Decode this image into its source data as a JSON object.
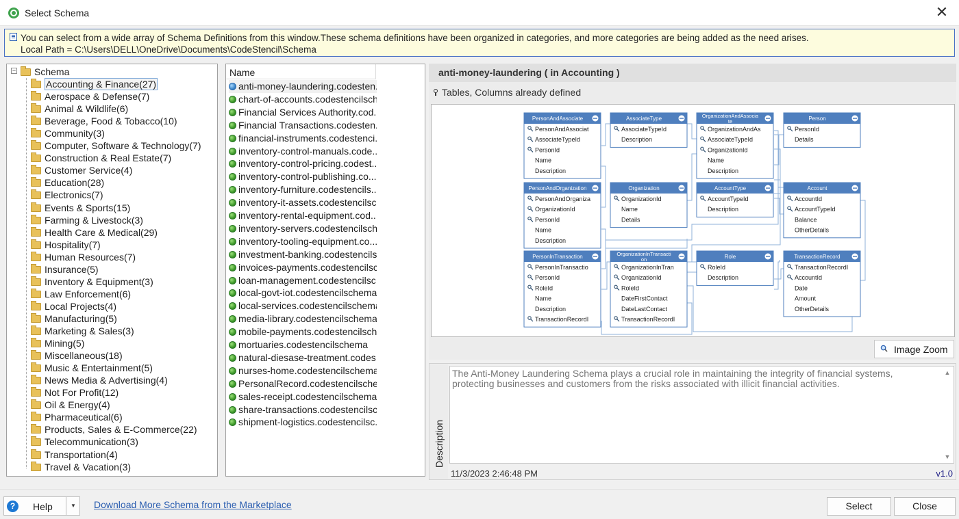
{
  "window": {
    "title": "Select Schema",
    "close_glyph": "✕"
  },
  "banner": {
    "line1": "You can select from a wide array of Schema Definitions from this window.These schema definitions have been organized in categories, and more categories are being added as the need arises.",
    "line2": "Local Path = C:\\Users\\DELL\\OneDrive\\Documents\\CodeStencil\\Schema"
  },
  "tree": {
    "root": "Schema",
    "expander": "−",
    "items": [
      {
        "label": "Accounting & Finance(27)",
        "selected": true
      },
      {
        "label": "Aerospace & Defense(7)"
      },
      {
        "label": "Animal & Wildlife(6)"
      },
      {
        "label": "Beverage, Food & Tobacco(10)"
      },
      {
        "label": "Community(3)"
      },
      {
        "label": "Computer, Software & Technology(7)"
      },
      {
        "label": "Construction & Real Estate(7)"
      },
      {
        "label": "Customer Service(4)"
      },
      {
        "label": "Education(28)"
      },
      {
        "label": "Electronics(7)"
      },
      {
        "label": "Events & Sports(15)"
      },
      {
        "label": "Farming & Livestock(3)"
      },
      {
        "label": "Health Care & Medical(29)"
      },
      {
        "label": "Hospitality(7)"
      },
      {
        "label": "Human Resources(7)"
      },
      {
        "label": "Insurance(5)"
      },
      {
        "label": "Inventory & Equipment(3)"
      },
      {
        "label": "Law Enforcement(6)"
      },
      {
        "label": "Local Projects(4)"
      },
      {
        "label": "Manufacturing(5)"
      },
      {
        "label": "Marketing & Sales(3)"
      },
      {
        "label": "Mining(5)"
      },
      {
        "label": "Miscellaneous(18)"
      },
      {
        "label": "Music & Entertainment(5)"
      },
      {
        "label": "News Media & Advertising(4)"
      },
      {
        "label": "Not For Profit(12)"
      },
      {
        "label": "Oil & Energy(4)"
      },
      {
        "label": "Pharmaceutical(6)"
      },
      {
        "label": "Products, Sales & E-Commerce(22)"
      },
      {
        "label": "Telecommunication(3)"
      },
      {
        "label": "Transportation(4)"
      },
      {
        "label": "Travel & Vacation(3)"
      }
    ]
  },
  "list": {
    "header": "Name",
    "items": [
      {
        "label": "anti-money-laundering.codesten...",
        "selected": true,
        "icon": "blue"
      },
      {
        "label": "chart-of-accounts.codestencilsch..."
      },
      {
        "label": "Financial Services Authority.cod..."
      },
      {
        "label": "Financial Transactions.codesten..."
      },
      {
        "label": "financial-instruments.codestenci..."
      },
      {
        "label": "inventory-control-manuals.code..."
      },
      {
        "label": "inventory-control-pricing.codest..."
      },
      {
        "label": "inventory-control-publishing.co..."
      },
      {
        "label": "inventory-furniture.codestencils..."
      },
      {
        "label": "inventory-it-assets.codestencilsc..."
      },
      {
        "label": "inventory-rental-equipment.cod..."
      },
      {
        "label": "inventory-servers.codestencilsch..."
      },
      {
        "label": "inventory-tooling-equipment.co..."
      },
      {
        "label": "investment-banking.codestencils..."
      },
      {
        "label": "invoices-payments.codestencilsc..."
      },
      {
        "label": "loan-management.codestencilsc..."
      },
      {
        "label": "local-govt-iot.codestencilschema"
      },
      {
        "label": "local-services.codestencilschema"
      },
      {
        "label": "media-library.codestencilschema"
      },
      {
        "label": "mobile-payments.codestencilsch..."
      },
      {
        "label": "mortuaries.codestencilschema"
      },
      {
        "label": "natural-diesase-treatment.codes..."
      },
      {
        "label": "nurses-home.codestencilschema"
      },
      {
        "label": "PersonalRecord.codestencilsche..."
      },
      {
        "label": "sales-receipt.codestencilschema"
      },
      {
        "label": "share-transactions.codestencilsc..."
      },
      {
        "label": "shipment-logistics.codestencilsc..."
      }
    ]
  },
  "detail": {
    "title": "anti-money-laundering ( in Accounting )",
    "tables_defined": "Tables, Columns already defined",
    "zoom_label": "Image Zoom",
    "description_tab": "Description",
    "description": "The Anti-Money Laundering Schema plays a crucial role in maintaining the integrity of financial systems, protecting businesses and customers from the risks associated with illicit financial activities.",
    "date": "11/3/2023 2:46:48 PM",
    "version": "v1.0"
  },
  "er_tables": [
    {
      "name": "PersonAndAssociate",
      "fields": [
        {
          "n": "PersonAndAssociat",
          "k": true
        },
        {
          "n": "AssociateTypeId",
          "k": true
        },
        {
          "n": "PersonId",
          "k": true
        },
        {
          "n": "Name"
        },
        {
          "n": "Description"
        }
      ]
    },
    {
      "name": "AssociateType",
      "fields": [
        {
          "n": "AssociateTypeId",
          "k": true
        },
        {
          "n": "Description"
        }
      ]
    },
    {
      "name": "OrganizationAndAssocia te",
      "fields": [
        {
          "n": "OrganizationAndAs",
          "k": true
        },
        {
          "n": "AssociateTypeId",
          "k": true
        },
        {
          "n": "OrganizationId",
          "k": true
        },
        {
          "n": "Name"
        },
        {
          "n": "Description"
        }
      ]
    },
    {
      "name": "Person",
      "fields": [
        {
          "n": "PersonId",
          "k": true
        },
        {
          "n": "Details"
        }
      ]
    },
    {
      "name": "PersonAndOrganization",
      "fields": [
        {
          "n": "PersonAndOrganiza",
          "k": true
        },
        {
          "n": "OrganizationId",
          "k": true
        },
        {
          "n": "PersonId",
          "k": true
        },
        {
          "n": "Name"
        },
        {
          "n": "Description"
        }
      ]
    },
    {
      "name": "Organization",
      "fields": [
        {
          "n": "OrganizationId",
          "k": true
        },
        {
          "n": "Name"
        },
        {
          "n": "Details"
        }
      ]
    },
    {
      "name": "AccountType",
      "fields": [
        {
          "n": "AccountTypeId",
          "k": true
        },
        {
          "n": "Description"
        }
      ]
    },
    {
      "name": "Account",
      "fields": [
        {
          "n": "AccountId",
          "k": true
        },
        {
          "n": "AccountTypeId",
          "k": true
        },
        {
          "n": "Balance"
        },
        {
          "n": "OtherDetails"
        }
      ]
    },
    {
      "name": "PersonInTransaction",
      "fields": [
        {
          "n": "PersonInTransactio",
          "k": true
        },
        {
          "n": "PersonId",
          "k": true
        },
        {
          "n": "RoleId",
          "k": true
        },
        {
          "n": "Name"
        },
        {
          "n": "Description"
        },
        {
          "n": "TransactionRecordI",
          "k": true
        }
      ]
    },
    {
      "name": "OrganizationInTransacti on",
      "fields": [
        {
          "n": "OrganizationInTran",
          "k": true
        },
        {
          "n": "OrganizationId",
          "k": true
        },
        {
          "n": "RoleId",
          "k": true
        },
        {
          "n": "DateFirstContact"
        },
        {
          "n": "DateLastContact"
        },
        {
          "n": "TransactionRecordI",
          "k": true
        }
      ]
    },
    {
      "name": "Role",
      "fields": [
        {
          "n": "RoleId",
          "k": true
        },
        {
          "n": "Description"
        }
      ]
    },
    {
      "name": "TransactionRecord",
      "fields": [
        {
          "n": "TransactionRecordI",
          "k": true
        },
        {
          "n": "AccountId",
          "k": true
        },
        {
          "n": "Date"
        },
        {
          "n": "Amount"
        },
        {
          "n": "OtherDetails"
        }
      ]
    }
  ],
  "bottom": {
    "help_label": "Help",
    "help_icon": "?",
    "marketplace_link": "Download More Schema from the Marketplace",
    "select_label": "Select",
    "close_label": "Close"
  },
  "colors": {
    "banner_bg": "#fdfcde",
    "er_header": "#4f7fbe",
    "link": "#2a5db0"
  }
}
